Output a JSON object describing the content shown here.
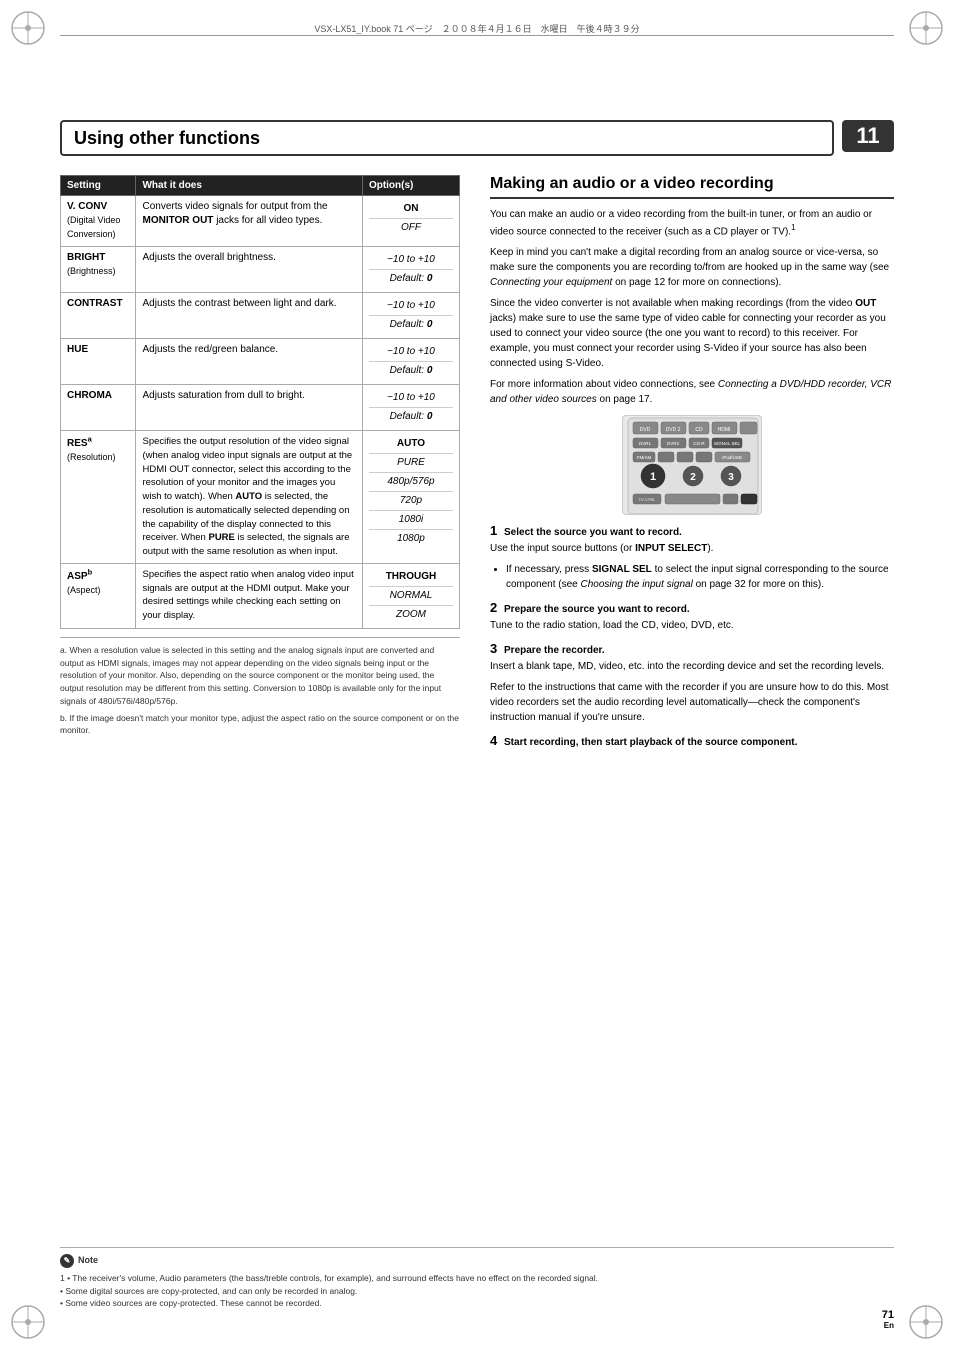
{
  "meta": {
    "file_info": "VSX-LX51_IY.book  71 ページ　２００８年４月１６日　水曜日　午後４時３９分",
    "page_number": "71",
    "page_sub": "En",
    "chapter_number": "11"
  },
  "section_title": "Using other functions",
  "table": {
    "headers": [
      "Setting",
      "What it does",
      "Option(s)"
    ],
    "rows": [
      {
        "setting": "V. CONV",
        "setting_sub": "(Digital Video Conversion)",
        "what": "Converts video signals for output from the MONITOR OUT jacks for all video types.",
        "what_bold": "MONITOR OUT",
        "options": [
          {
            "text": "ON",
            "style": "bold"
          },
          {
            "text": "OFF",
            "style": "normal"
          }
        ]
      },
      {
        "setting": "BRIGHT",
        "setting_sub": "(Brightness)",
        "what": "Adjusts the overall brightness.",
        "options": [
          {
            "text": "−10 to +10",
            "style": "normal"
          },
          {
            "text": "Default: 0",
            "style": "normal"
          }
        ]
      },
      {
        "setting": "CONTRAST",
        "setting_sub": "",
        "what": "Adjusts the contrast between light and dark.",
        "options": [
          {
            "text": "−10 to +10",
            "style": "normal"
          },
          {
            "text": "Default: 0",
            "style": "normal"
          }
        ]
      },
      {
        "setting": "HUE",
        "setting_sub": "",
        "what": "Adjusts the red/green balance.",
        "options": [
          {
            "text": "−10 to +10",
            "style": "normal"
          },
          {
            "text": "Default: 0",
            "style": "normal"
          }
        ]
      },
      {
        "setting": "CHROMA",
        "setting_sub": "",
        "what": "Adjusts saturation from dull to bright.",
        "options": [
          {
            "text": "−10 to +10",
            "style": "normal"
          },
          {
            "text": "Default: 0",
            "style": "normal"
          }
        ]
      },
      {
        "setting": "RES",
        "setting_sub_sup": "a",
        "setting_sub2": "(Resolution)",
        "what": "Specifies the output resolution of the video signal (when analog video input signals are output at the HDMI OUT connector, select this according to the resolution of your monitor and the images you wish to watch). When AUTO is selected, the resolution is automatically selected depending on the capability of the display connected to this receiver. When PURE is selected, the signals are output with the same resolution as when input.",
        "options": [
          {
            "text": "AUTO",
            "style": "bold"
          },
          {
            "text": "PURE",
            "style": "italic"
          },
          {
            "text": "480p/576p",
            "style": "italic"
          },
          {
            "text": "720p",
            "style": "italic"
          },
          {
            "text": "1080i",
            "style": "italic"
          },
          {
            "text": "1080p",
            "style": "italic"
          }
        ]
      },
      {
        "setting": "ASP",
        "setting_sub_sup": "b",
        "setting_sub2": "(Aspect)",
        "what": "Specifies the aspect ratio when analog video input signals are output at the HDMI output. Make your desired settings while checking each setting on your display.",
        "options": [
          {
            "text": "THROUGH",
            "style": "bold"
          },
          {
            "text": "NORMAL",
            "style": "italic"
          },
          {
            "text": "ZOOM",
            "style": "italic"
          }
        ]
      }
    ],
    "footnotes": [
      "a. When a resolution value is selected in this setting and the analog signals input are converted and output as HDMI signals, images may not appear depending on the video signals being input or the resolution of your monitor. Also, depending on the source component or the monitor being used, the output resolution may be different from this setting. Conversion to 1080p is available only for the input signals of 480i/576i/480p/576p.",
      "b. If the image doesn't match your monitor type, adjust the aspect ratio on the source component or on the monitor."
    ]
  },
  "right_section": {
    "heading": "Making an audio or a video recording",
    "paragraphs": [
      "You can make an audio or a video recording from the built-in tuner, or from an audio or video source connected to the receiver (such as a CD player or TV).",
      "Keep in mind you can't make a digital recording from an analog source or vice-versa, so make sure the components you are recording to/from are hooked up in the same way (see Connecting your equipment on page 12 for more on connections).",
      "Since the video converter is not available when making recordings (from the video OUT jacks) make sure to use the same type of video cable for connecting your recorder as you used to connect your video source (the one you want to record) to this receiver. For example, you must connect your recorder using S-Video if your source has also been connected using S-Video.",
      "For more information about video connections, see Connecting a DVD/HDD recorder, VCR and other video sources on page 17."
    ],
    "steps": [
      {
        "num": "1",
        "heading": "Select the source you want to record.",
        "body": "Use the input source buttons (or INPUT SELECT).",
        "bullets": [
          "If necessary, press SIGNAL SEL to select the input signal corresponding to the source component (see Choosing the input signal on page 32 for more on this)."
        ]
      },
      {
        "num": "2",
        "heading": "Prepare the source you want to record.",
        "body": "Tune to the radio station, load the CD, video, DVD, etc.",
        "bullets": []
      },
      {
        "num": "3",
        "heading": "Prepare the recorder.",
        "body": "Insert a blank tape, MD, video, etc. into the recording device and set the recording levels.\n\nRefer to the instructions that came with the recorder if you are unsure how to do this. Most video recorders set the audio recording level automatically—check the component's instruction manual if you're unsure.",
        "bullets": []
      },
      {
        "num": "4",
        "heading": "Start recording, then start playback of the source component.",
        "body": "",
        "bullets": []
      }
    ]
  },
  "note": {
    "label": "Note",
    "items": [
      "The receiver's volume, Audio parameters (the bass/treble controls, for example), and surround effects have no effect on the recorded signal.",
      "Some digital sources are copy-protected, and can only be recorded in analog.",
      "Some video sources are copy-protected. These cannot be recorded."
    ]
  }
}
